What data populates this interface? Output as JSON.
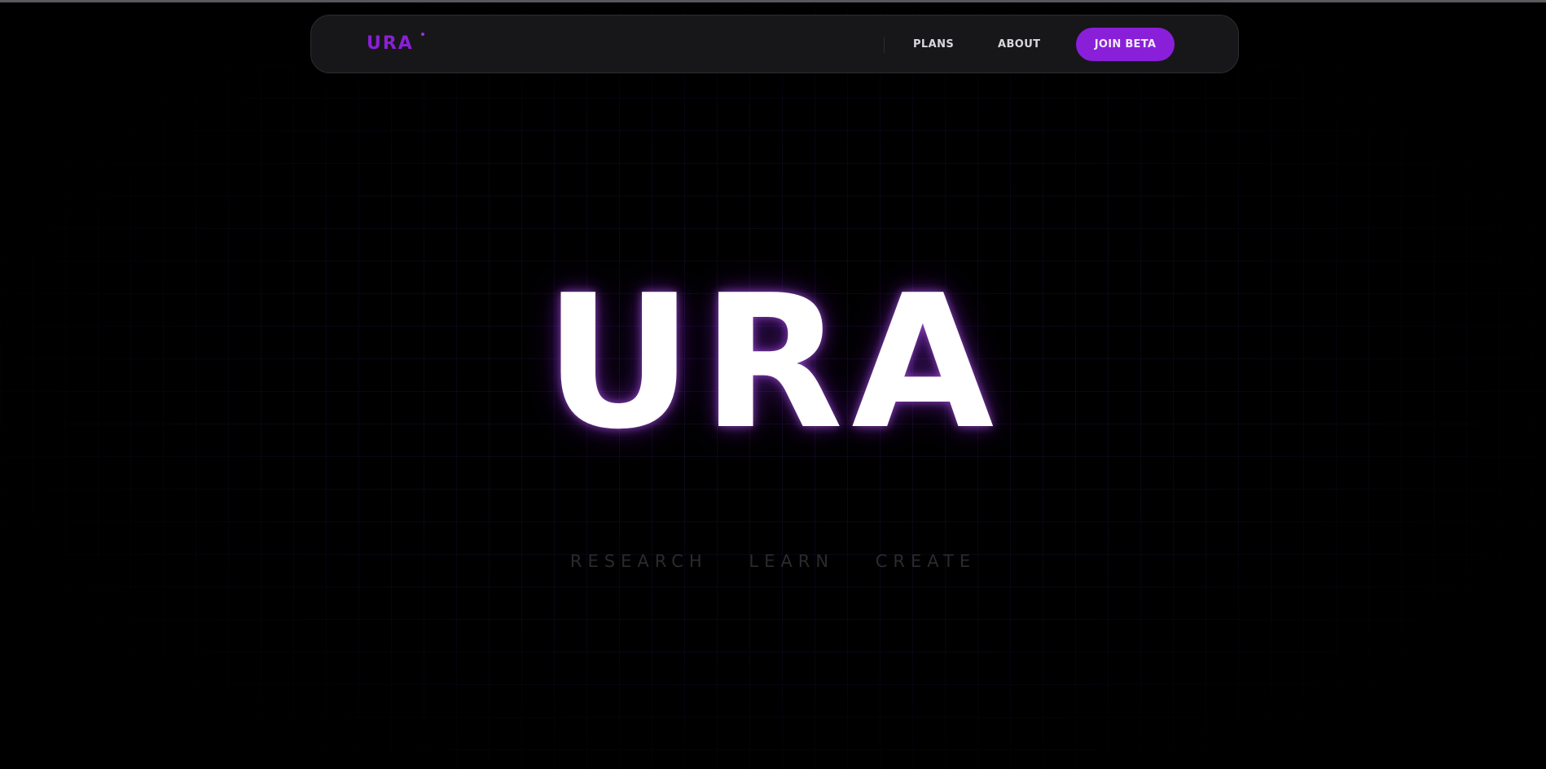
{
  "navbar": {
    "logo": "URA",
    "links": [
      {
        "label": "PLANS"
      },
      {
        "label": "ABOUT"
      }
    ],
    "cta_label": "JOIN BETA"
  },
  "hero": {
    "title": "URA",
    "taglines": [
      "RESEARCH",
      "LEARN",
      "CREATE"
    ]
  },
  "colors": {
    "background": "#000000",
    "accent": "#8a1fd9",
    "grid": "#462882",
    "title": "#ffffff",
    "tagline": "#2a2a2f"
  }
}
